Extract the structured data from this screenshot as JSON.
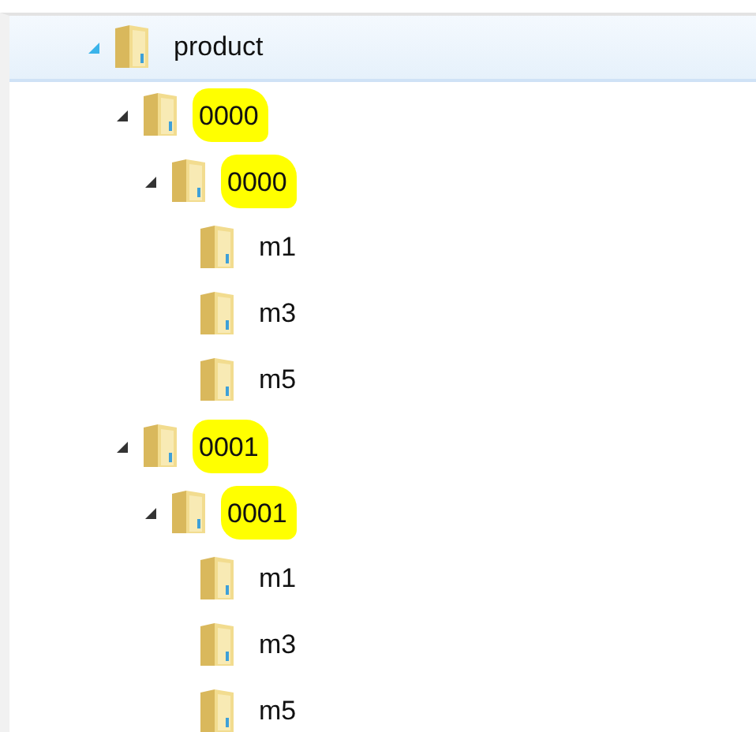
{
  "tree": [
    {
      "label": "product",
      "expanded": true,
      "hovered": true,
      "highlighted": false,
      "children": [
        {
          "label": "0000",
          "expanded": true,
          "hovered": false,
          "highlighted": true,
          "children": [
            {
              "label": "0000",
              "expanded": true,
              "hovered": false,
              "highlighted": true,
              "children": [
                {
                  "label": "m1",
                  "hovered": false,
                  "highlighted": false
                },
                {
                  "label": "m3",
                  "hovered": false,
                  "highlighted": false
                },
                {
                  "label": "m5",
                  "hovered": false,
                  "highlighted": false
                }
              ]
            }
          ]
        },
        {
          "label": "0001",
          "expanded": true,
          "hovered": false,
          "highlighted": true,
          "children": [
            {
              "label": "0001",
              "expanded": true,
              "hovered": false,
              "highlighted": true,
              "children": [
                {
                  "label": "m1",
                  "hovered": false,
                  "highlighted": false
                },
                {
                  "label": "m3",
                  "hovered": false,
                  "highlighted": false
                },
                {
                  "label": "m5",
                  "hovered": false,
                  "highlighted": false
                }
              ]
            }
          ]
        }
      ]
    }
  ]
}
